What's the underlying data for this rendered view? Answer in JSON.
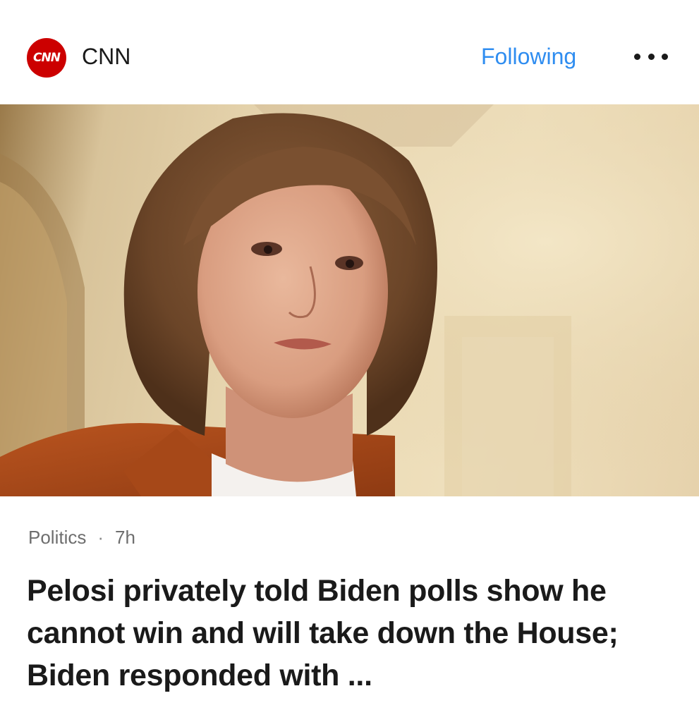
{
  "header": {
    "logo_text": "CNN",
    "logo_color": "#cc0000",
    "source_name": "CNN",
    "follow_label": "Following",
    "follow_color": "#2f8df0",
    "more_icon": "more-horizontal-icon"
  },
  "article": {
    "category": "Politics",
    "separator": "·",
    "age": "7h",
    "headline": "Pelosi privately told Biden polls show he cannot win and will take down the House; Biden responded with ..."
  }
}
